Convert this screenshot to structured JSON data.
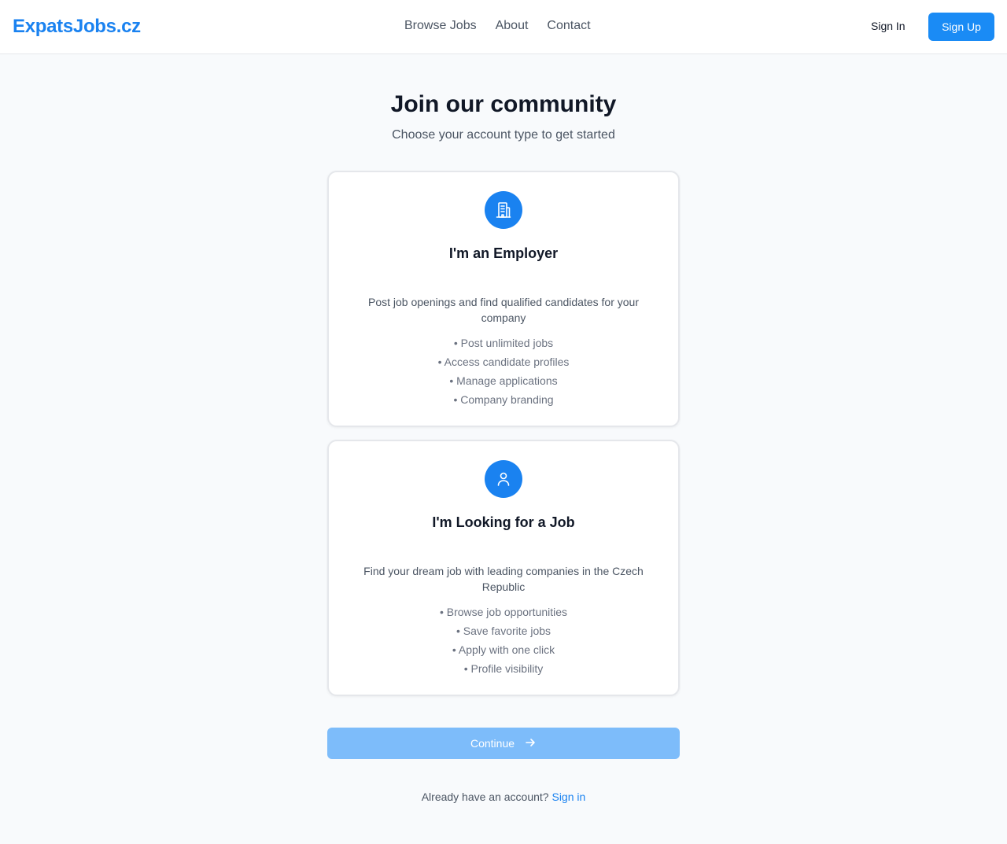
{
  "header": {
    "logo": "ExpatsJobs.cz",
    "nav": [
      {
        "label": "Browse Jobs"
      },
      {
        "label": "About"
      },
      {
        "label": "Contact"
      }
    ],
    "sign_in": "Sign In",
    "sign_up": "Sign Up"
  },
  "hero": {
    "title": "Join our community",
    "subtitle": "Choose your account type to get started"
  },
  "cards": {
    "employer": {
      "icon": "building-icon",
      "title": "I'm an Employer",
      "description": "Post job openings and find qualified candidates for your company",
      "features": [
        "• Post unlimited jobs",
        "• Access candidate profiles",
        "• Manage applications",
        "• Company branding"
      ]
    },
    "seeker": {
      "icon": "user-icon",
      "title": "I'm Looking for a Job",
      "description": "Find your dream job with leading companies in the Czech Republic",
      "features": [
        "• Browse job opportunities",
        "• Save favorite jobs",
        "• Apply with one click",
        "• Profile visibility"
      ]
    }
  },
  "continue": {
    "label": "Continue",
    "icon": "arrow-right-icon",
    "enabled": false
  },
  "footer": {
    "prompt": "Already have an account?",
    "link": "Sign in"
  },
  "colors": {
    "brand": "#1a82f0",
    "button_primary": "#1a8bf5",
    "button_disabled": "#7dbcfa",
    "background": "#f8fafc"
  }
}
